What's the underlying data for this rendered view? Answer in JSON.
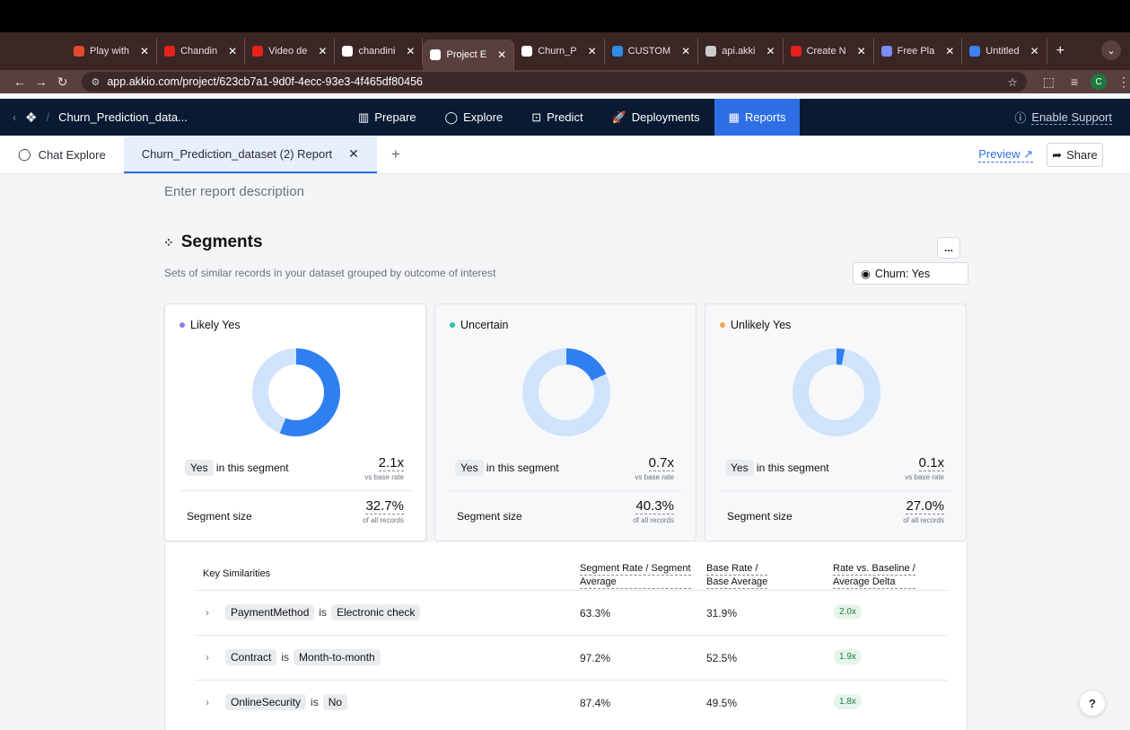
{
  "browser": {
    "tabs": [
      {
        "label": "Play with",
        "color": "#e14b2b"
      },
      {
        "label": "Chandin",
        "color": "#e62117"
      },
      {
        "label": "Video de",
        "color": "#e62117"
      },
      {
        "label": "chandini",
        "color": "#ffffff"
      },
      {
        "label": "Project E",
        "color": "#ffffff"
      },
      {
        "label": "Churn_P",
        "color": "#ffffff"
      },
      {
        "label": "CUSTOM",
        "color": "#2f8be6"
      },
      {
        "label": "api.akki",
        "color": "#cccccc"
      },
      {
        "label": "Create N",
        "color": "#e62117"
      },
      {
        "label": "Free Pla",
        "color": "#7c8cff"
      },
      {
        "label": "Untitled",
        "color": "#3b82f6"
      }
    ],
    "active_tab_index": 4,
    "url": "app.akkio.com/project/623cb7a1-9d0f-4ecc-93e3-4f465df80456",
    "profile_initial": "C"
  },
  "app": {
    "project_name": "Churn_Prediction_data...",
    "nav": [
      {
        "label": "Prepare",
        "icon": "▥"
      },
      {
        "label": "Explore",
        "icon": "◯"
      },
      {
        "label": "Predict",
        "icon": "⊡"
      },
      {
        "label": "Deployments",
        "icon": "🚀"
      },
      {
        "label": "Reports",
        "icon": "▦"
      }
    ],
    "active_nav_index": 4,
    "support_label": "Enable Support"
  },
  "report_tabs": {
    "chat_explore": "Chat Explore",
    "active_report": "Churn_Prediction_dataset (2) Report",
    "preview_label": "Preview",
    "share_label": "Share"
  },
  "report": {
    "description_placeholder": "Enter report description",
    "section_title": "Segments",
    "section_subtitle": "Sets of similar records in your dataset grouped by outcome of interest",
    "filter_label": "Churn: Yes",
    "more_label": "..."
  },
  "segments": [
    {
      "name": "Likely Yes",
      "dot_color": "#8b7cf6",
      "fraction": 0.56,
      "tag": "Yes",
      "in_segment_label": "in this segment",
      "rate": "2.1x",
      "rate_caption": "vs base rate",
      "size_label": "Segment size",
      "size": "32.7%",
      "size_caption": "of all records"
    },
    {
      "name": "Uncertain",
      "dot_color": "#2bbfb3",
      "fraction": 0.18,
      "tag": "Yes",
      "in_segment_label": "in this segment",
      "rate": "0.7x",
      "rate_caption": "vs base rate",
      "size_label": "Segment size",
      "size": "40.3%",
      "size_caption": "of all records"
    },
    {
      "name": "Unlikely Yes",
      "dot_color": "#f2a65a",
      "fraction": 0.03,
      "tag": "Yes",
      "in_segment_label": "in this segment",
      "rate": "0.1x",
      "rate_caption": "vs base rate",
      "size_label": "Segment size",
      "size": "27.0%",
      "size_caption": "of all records"
    }
  ],
  "colors": {
    "donut_fill": "#2f7ff0",
    "donut_track": "#cfe3fb",
    "accent": "#2f6fe6",
    "header_bg": "#0a1a33"
  },
  "similarities": {
    "headers": {
      "key": "Key Similarities",
      "segment_line1": "Segment Rate / Segment",
      "segment_line2": "Average",
      "base_line1": "Base Rate /",
      "base_line2": "Base Average",
      "delta_line1": "Rate vs. Baseline /",
      "delta_line2": "Average Delta"
    },
    "rows": [
      {
        "field": "PaymentMethod",
        "op": "is",
        "value": "Electronic check",
        "segment_rate": "63.3%",
        "base_rate": "31.9%",
        "delta": "2.0x"
      },
      {
        "field": "Contract",
        "op": "is",
        "value": "Month-to-month",
        "segment_rate": "97.2%",
        "base_rate": "52.5%",
        "delta": "1.9x"
      },
      {
        "field": "OnlineSecurity",
        "op": "is",
        "value": "No",
        "segment_rate": "87.4%",
        "base_rate": "49.5%",
        "delta": "1.8x"
      }
    ]
  },
  "help_label": "?"
}
